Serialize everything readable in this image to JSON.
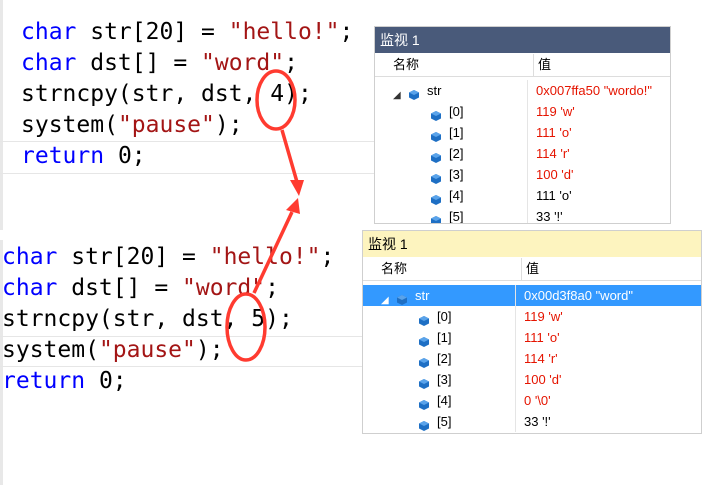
{
  "snippet1": {
    "lines": [
      {
        "parts": [
          {
            "t": "char",
            "c": "kw"
          },
          {
            "t": " str[20] = ",
            "c": ""
          },
          {
            "t": "\"hello!\"",
            "c": "str"
          },
          {
            "t": ";",
            "c": ""
          }
        ]
      },
      {
        "parts": [
          {
            "t": "char",
            "c": "kw"
          },
          {
            "t": " dst[] = ",
            "c": ""
          },
          {
            "t": "\"word\"",
            "c": "str"
          },
          {
            "t": ";",
            "c": ""
          }
        ]
      },
      {
        "parts": [
          {
            "t": "strncpy(str, dst, 4);",
            "c": ""
          }
        ]
      },
      {
        "parts": [
          {
            "t": "system(",
            "c": ""
          },
          {
            "t": "\"pause\"",
            "c": "str"
          },
          {
            "t": ");",
            "c": ""
          }
        ]
      },
      {
        "parts": [
          {
            "t": "return",
            "c": "kw"
          },
          {
            "t": " 0;",
            "c": ""
          }
        ]
      }
    ]
  },
  "snippet2": {
    "lines": [
      {
        "parts": [
          {
            "t": "char",
            "c": "kw"
          },
          {
            "t": " str[20] = ",
            "c": ""
          },
          {
            "t": "\"hello!\"",
            "c": "str"
          },
          {
            "t": ";",
            "c": ""
          }
        ]
      },
      {
        "parts": [
          {
            "t": "char",
            "c": "kw"
          },
          {
            "t": " dst[] = ",
            "c": ""
          },
          {
            "t": "\"word\"",
            "c": "str"
          },
          {
            "t": ";",
            "c": ""
          }
        ]
      },
      {
        "parts": [
          {
            "t": "strncpy(str, dst, 5);",
            "c": ""
          }
        ]
      },
      {
        "parts": [
          {
            "t": "system(",
            "c": ""
          },
          {
            "t": "\"pause\"",
            "c": "str"
          },
          {
            "t": ");",
            "c": ""
          }
        ]
      },
      {
        "parts": [
          {
            "t": "return",
            "c": "kw"
          },
          {
            "t": " 0;",
            "c": ""
          }
        ]
      }
    ]
  },
  "watch1": {
    "title": "监视 1",
    "col_name": "名称",
    "col_value": "值",
    "title_bg": "#495a7a",
    "rows": [
      {
        "name": "str",
        "value": "0x007ffa50 \"wordo!\"",
        "red": true,
        "parent": true
      },
      {
        "name": "[0]",
        "value": "119 'w'",
        "red": true
      },
      {
        "name": "[1]",
        "value": "111 'o'",
        "red": true
      },
      {
        "name": "[2]",
        "value": "114 'r'",
        "red": true
      },
      {
        "name": "[3]",
        "value": "100 'd'",
        "red": true
      },
      {
        "name": "[4]",
        "value": "111 'o'",
        "red": false
      },
      {
        "name": "[5]",
        "value": "33 '!'",
        "red": false
      }
    ]
  },
  "watch2": {
    "title": "监视 1",
    "col_name": "名称",
    "col_value": "值",
    "title_bg": "#fdf4bf",
    "rows": [
      {
        "name": "str",
        "value": "0x00d3f8a0 \"word\"",
        "red": false,
        "parent": true,
        "selected": true
      },
      {
        "name": "[0]",
        "value": "119 'w'",
        "red": true
      },
      {
        "name": "[1]",
        "value": "111 'o'",
        "red": true
      },
      {
        "name": "[2]",
        "value": "114 'r'",
        "red": true
      },
      {
        "name": "[3]",
        "value": "100 'd'",
        "red": true
      },
      {
        "name": "[4]",
        "value": "0 '\\0'",
        "red": true
      },
      {
        "name": "[5]",
        "value": "33 '!'",
        "red": false
      }
    ]
  },
  "colors": {
    "keyword": "#0000ff",
    "string": "#a31515",
    "changed_value": "#e51400",
    "annotation": "#ff3b30",
    "cube": "#1e6fc4"
  }
}
